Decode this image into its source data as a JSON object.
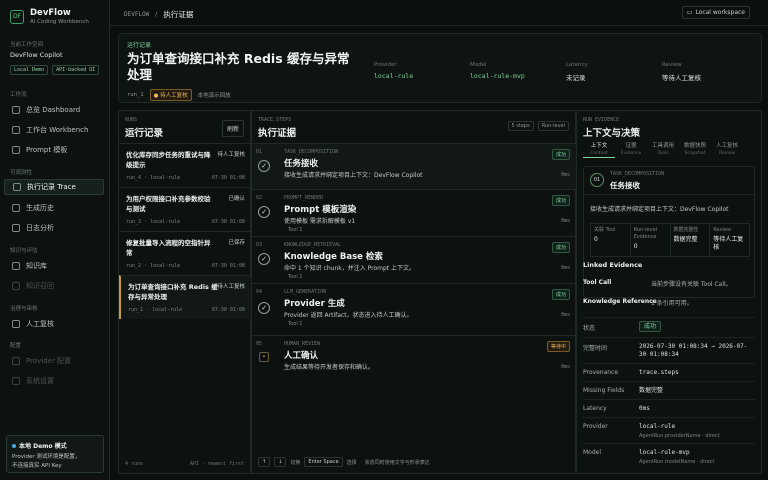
{
  "brand": {
    "logo": "DF",
    "title": "DevFlow",
    "subtitle": "AI Coding Workbench"
  },
  "workspace": {
    "label": "当前工作空间",
    "name": "DevFlow Copilot",
    "chips": [
      "Local Demo",
      "API-backed UI"
    ]
  },
  "nav": {
    "groups": [
      "工作流",
      "可观测性",
      "知识与评估",
      "治理与审核",
      "配置"
    ],
    "items": [
      {
        "label": "总览 Dashboard",
        "icon": "dashboard-icon"
      },
      {
        "label": "工作台 Workbench",
        "icon": "workbench-icon"
      },
      {
        "label": "Prompt 模板",
        "icon": "prompt-icon"
      },
      {
        "label": "执行记录 Trace",
        "icon": "trace-icon"
      },
      {
        "label": "生成历史",
        "icon": "history-icon"
      },
      {
        "label": "日志分析",
        "icon": "log-icon"
      },
      {
        "label": "知识库",
        "icon": "knowledge-icon"
      },
      {
        "label": "知识召回",
        "icon": "recall-icon"
      },
      {
        "label": "人工复核",
        "icon": "review-icon"
      },
      {
        "label": "Provider 配置",
        "icon": "provider-icon"
      },
      {
        "label": "系统设置",
        "icon": "settings-icon"
      }
    ]
  },
  "demo": {
    "title": "本地 Demo 模式",
    "line1": "Provider 测试环境是配置，",
    "line2": "不连接真实 API Key"
  },
  "topbar": {
    "root": "DEVFLOW",
    "sep": "/",
    "current": "执行证据",
    "local_btn": "Local workspace"
  },
  "hero": {
    "eyebrow": "运行记录",
    "title": "为订单查询接口补充 Redis 缓存与异常处理",
    "run_id": "run_1",
    "status": "待人工复核",
    "note": "本地演示回放",
    "cols": [
      {
        "label": "Provider",
        "value": "local-rule"
      },
      {
        "label": "Model",
        "value": "local-rule-mvp"
      },
      {
        "label": "Latency",
        "value": "未记录"
      },
      {
        "label": "Review",
        "value": "等待人工复核"
      }
    ]
  },
  "runs": {
    "eyebrow": "RUNS",
    "title": "运行记录",
    "refresh": "刷新",
    "items": [
      {
        "title": "优化库存同步任务的重试与降级提示",
        "status": "待人工复核",
        "meta": "run_4 · local-rule",
        "time": "07-30 01:08"
      },
      {
        "title": "为用户权限接口补充参数校验与测试",
        "status": "已确认",
        "meta": "run_3 · local-rule",
        "time": "07-30 01:08"
      },
      {
        "title": "修复批量导入流程的空指针异常",
        "status": "已保存",
        "meta": "run_2 · local-rule",
        "time": "07-30 01:08"
      },
      {
        "title": "为订单查询接口补充 Redis 缓存与异常处理",
        "status": "待人工复核",
        "meta": "run_1 · local-rule",
        "time": "07-30 01:08"
      }
    ],
    "footer_left": "4 runs",
    "footer_right": "API · newest first"
  },
  "trace": {
    "eyebrow": "TRACE.STEPS",
    "title": "执行证据",
    "steps_count": "5 steps",
    "level": "Run-level",
    "steps": [
      {
        "no": "01",
        "kind": "TASK_DECOMPOSITION",
        "title": "任务接收",
        "desc": "接收生成请求并绑定项目上下文：DevFlow Copilot",
        "tool": "",
        "badge": "成功",
        "ms": "0ms",
        "mark": "✓"
      },
      {
        "no": "02",
        "kind": "PROMPT_RENDER",
        "title": "Prompt 模板渲染",
        "desc": "使用模板 需求拆解模板 v1",
        "tool": "Tool 1",
        "badge": "成功",
        "ms": "0ms",
        "mark": "✓"
      },
      {
        "no": "03",
        "kind": "KNOWLEDGE_RETRIEVAL",
        "title": "Knowledge Base 检索",
        "desc": "命中 1 个知识 chunk，并注入 Prompt 上下文。",
        "tool": "Tool 1",
        "badge": "成功",
        "ms": "0ms",
        "mark": "✓"
      },
      {
        "no": "04",
        "kind": "LLM_GENERATION",
        "title": "Provider 生成",
        "desc": "Provider 返回 Artifact，状态进入待人工确认。",
        "tool": "Tool 1",
        "badge": "成功",
        "ms": "0ms",
        "mark": "✓"
      },
      {
        "no": "05",
        "kind": "HUMAN_REVIEW",
        "title": "人工确认",
        "desc": "生成结果等待开发者保存和确认。",
        "tool": "",
        "badge": "等待中",
        "ms": "0ms",
        "mark": "•"
      }
    ],
    "footer": {
      "key_up": "↑",
      "key_down": "↓",
      "switch": "切换",
      "enter": "Enter Space",
      "select": "选择",
      "hint": "状态同时使用文字与形状表达"
    }
  },
  "evidence": {
    "eyebrow": "RUN EVIDENCE",
    "title": "上下文与决策",
    "tabs": [
      {
        "label": "上下文",
        "sub": "Context"
      },
      {
        "label": "证据",
        "sub": "Evidence"
      },
      {
        "label": "工具调用",
        "sub": "Tools"
      },
      {
        "label": "数据快照",
        "sub": "Snapshot"
      },
      {
        "label": "人工复核",
        "sub": "Review"
      }
    ],
    "card": {
      "no": "01",
      "kind": "TASK_DECOMPOSITION",
      "name": "任务接收",
      "desc": "接收生成请求并绑定项目上下文：DevFlow Copilot",
      "cells": [
        {
          "label": "关联 Tool",
          "value": "0"
        },
        {
          "label": "Run-level Evidence",
          "value": "0"
        },
        {
          "label": "数据完整性",
          "value": "数据完整"
        },
        {
          "label": "Review",
          "value": "等待人工复核"
        }
      ]
    },
    "linked_title": "Linked Evidence",
    "tool_call_label": "Tool Call",
    "tool_call_value": "当前步骤没有关联 Tool Call。",
    "kr_label": "Knowledge Reference",
    "kr_value": "1 条引用可用。",
    "rows": [
      {
        "k": "状态",
        "v": "成功",
        "sub": ""
      },
      {
        "k": "完整时间",
        "v": "2026-07-30 01:08:34 → 2026-07-30 01:08:34",
        "sub": ""
      },
      {
        "k": "Provenance",
        "v": "trace.steps",
        "sub": ""
      },
      {
        "k": "Missing Fields",
        "v": "数据完整",
        "sub": ""
      },
      {
        "k": "Latency",
        "v": "0ms",
        "sub": ""
      },
      {
        "k": "Provider",
        "v": "local-rule",
        "sub": "AgentRun.providerName · direct"
      },
      {
        "k": "Model",
        "v": "local-rule-mvp",
        "sub": "AgentRun.modelName · direct"
      }
    ]
  }
}
